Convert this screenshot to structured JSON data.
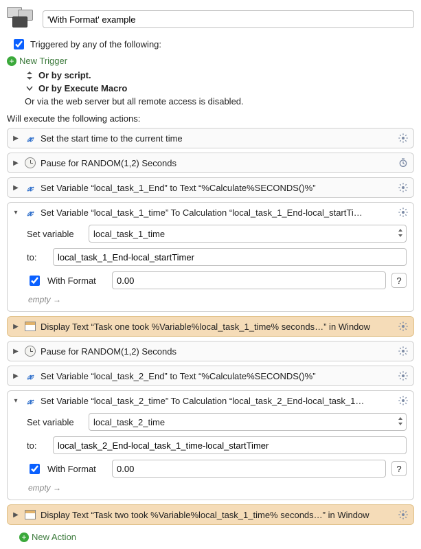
{
  "header": {
    "title_value": "'With Format' example"
  },
  "trigger": {
    "checkbox_label": "Triggered by any of the following:",
    "new_trigger_label": "New Trigger",
    "or_by_script": "Or by script.",
    "or_by_execute_macro": "Or by Execute Macro",
    "or_via_web": "Or via the web server but all remote access is disabled."
  },
  "actions_label": "Will execute the following actions:",
  "actions": {
    "a0": {
      "title": "Set the start time to the current time"
    },
    "a1": {
      "title": "Pause for RANDOM(1,2) Seconds"
    },
    "a2": {
      "title": "Set Variable “local_task_1_End” to Text “%Calculate%SECONDS()%”"
    },
    "a3": {
      "title": "Set Variable “local_task_1_time” To Calculation “local_task_1_End-local_startTi…",
      "set_variable_label": "Set variable",
      "variable_value": "local_task_1_time",
      "to_label": "to:",
      "to_value": "local_task_1_End-local_startTimer",
      "with_format_label": "With Format",
      "format_value": "0.00",
      "empty_note": "empty →"
    },
    "a4": {
      "title": "Display Text “Task one took %Variable%local_task_1_time% seconds…” in Window"
    },
    "a5": {
      "title": "Pause for RANDOM(1,2) Seconds"
    },
    "a6": {
      "title": "Set Variable “local_task_2_End” to Text “%Calculate%SECONDS()%”"
    },
    "a7": {
      "title": "Set Variable “local_task_2_time” To Calculation “local_task_2_End-local_task_1…",
      "set_variable_label": "Set variable",
      "variable_value": "local_task_2_time",
      "to_label": "to:",
      "to_value": "local_task_2_End-local_task_1_time-local_startTimer",
      "with_format_label": "With Format",
      "format_value": "0.00",
      "empty_note": "empty →"
    },
    "a8": {
      "title": "Display Text “Task two took %Variable%local_task_1_time% seconds…” in Window"
    }
  },
  "new_action_label": "New Action"
}
